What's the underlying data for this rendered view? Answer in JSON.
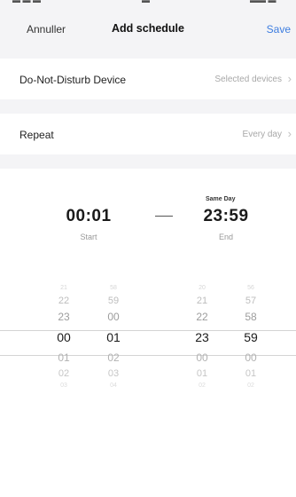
{
  "header": {
    "cancel_label": "Annuller",
    "title": "Add schedule",
    "save_label": "Save"
  },
  "settings": {
    "dnd_device": {
      "label": "Do-Not-Disturb Device",
      "value": "Selected devices"
    },
    "repeat": {
      "label": "Repeat",
      "value": "Every day"
    }
  },
  "schedule": {
    "start_time": "00:01",
    "start_label": "Start",
    "end_note": "Same Day",
    "end_time": "23:59",
    "end_label": "End"
  },
  "picker": {
    "columns": [
      {
        "name": "start-hour",
        "values": [
          "21",
          "22",
          "23",
          "00",
          "01",
          "02",
          "03"
        ]
      },
      {
        "name": "start-minute",
        "values": [
          "58",
          "59",
          "00",
          "01",
          "02",
          "03",
          "04"
        ]
      },
      {
        "name": "end-hour",
        "values": [
          "20",
          "21",
          "22",
          "23",
          "00",
          "01",
          "02"
        ]
      },
      {
        "name": "end-minute",
        "values": [
          "56",
          "57",
          "58",
          "59",
          "00",
          "01",
          "02"
        ]
      }
    ]
  },
  "icons": {
    "chevron": "chevron-right-icon",
    "separator": "dash-separator"
  },
  "colors": {
    "accent": "#3d7de0",
    "background": "#f4f4f6"
  }
}
